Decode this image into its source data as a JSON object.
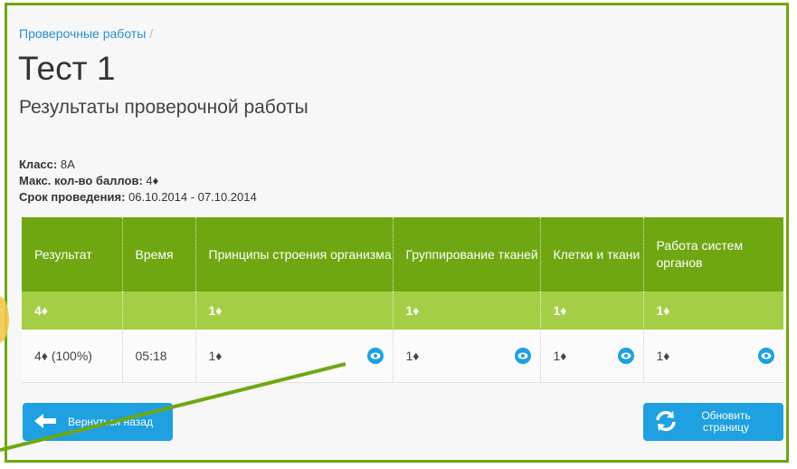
{
  "breadcrumb": {
    "link": "Проверочные работы",
    "separator": "/"
  },
  "title": "Тест 1",
  "subtitle": "Результаты проверочной работы",
  "meta": {
    "class_label": "Класс:",
    "class_value": "8А",
    "max_label": "Макс. кол-во баллов:",
    "max_value": "4♦",
    "period_label": "Срок проведения:",
    "period_value": "06.10.2014 - 07.10.2014"
  },
  "table": {
    "headers": [
      "Результат",
      "Время",
      "Принципы строения организма",
      "Группирование тканей",
      "Клетки и ткани",
      "Работа систем органов"
    ],
    "max_row": [
      "4♦",
      "",
      "1♦",
      "1♦",
      "1♦",
      "1♦"
    ],
    "result_row": [
      "4♦ (100%)",
      "05:18",
      "1♦",
      "1♦",
      "1♦",
      "1♦"
    ]
  },
  "buttons": {
    "back": "Вернуться назад",
    "refresh": "Обновить страницу"
  },
  "colors": {
    "accent_green": "#6ea711",
    "light_green": "#a5ce47",
    "blue": "#1ea0e1"
  }
}
